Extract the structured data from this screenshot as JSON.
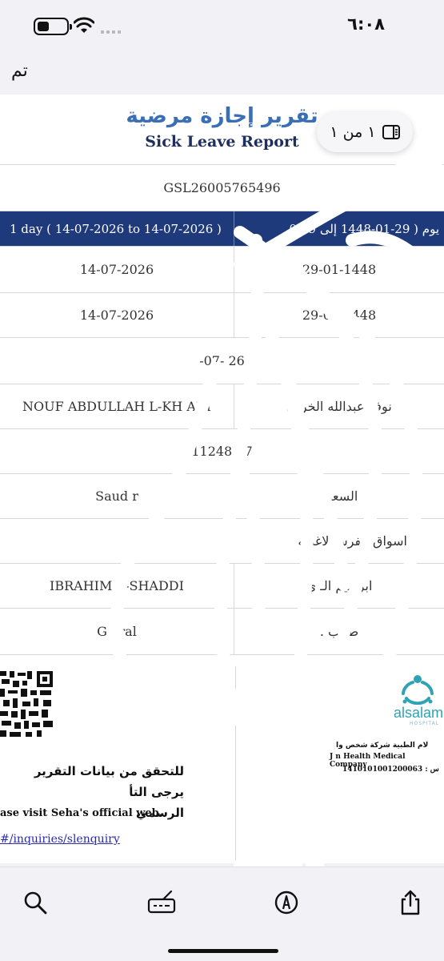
{
  "status_bar": {
    "time": "٦:٠٨"
  },
  "nav": {
    "done_label": "تم"
  },
  "page_indicator": {
    "label": "١ من ١"
  },
  "report": {
    "title_ar": "تقرير إجازة مرضية",
    "title_en": "Sick Leave Report",
    "leave_id": "GSL26005765496",
    "duration_en": "1 day  (  14-07-2026  to  14-07-2026  )",
    "duration_ar": "يوم  (  29-01-1448  إلى  29-0",
    "admission_date_en": "14-07-2026",
    "admission_date_ar": "29-01-1448",
    "discharge_date_en": "14-07-2026",
    "discharge_date_ar": "29-01-1448",
    "issue_date": "-07-   26",
    "name_en": "NOUF ABDULLAH  L-KH   AIJI",
    "name_ar": "نوف عبدالله الخر   ي",
    "national_id": "11248   87",
    "nationality_en": "Saud   r",
    "nationality_ar": "السعود",
    "employer": "اسواق الفرسا   لاغذيه",
    "doctor_en": "IBRAHIM   L-SHADDI",
    "doctor_ar": "ابراهيم الـ   ي",
    "position_en": "G   eral",
    "position_ar": "طبيب ."
  },
  "footer": {
    "verify_ar_line1": "للتحقق من بيانات التقرير يرجى التأ",
    "verify_ar_line2": "الرسمي",
    "verify_en": "ase visit Seha's official web.",
    "verify_link": "#/inquiries/slenquiry",
    "logo_name": "alsalam",
    "logo_sub": "HOSPITAL",
    "company_ar": "لام الطبية شركة شخص وا",
    "company_en": "J   n Health Medical Company",
    "company_id": "1410101001200063  :  س"
  },
  "toolbar": {
    "items": [
      "search-icon",
      "signature-icon",
      "markup-pen-icon",
      "share-icon"
    ]
  }
}
